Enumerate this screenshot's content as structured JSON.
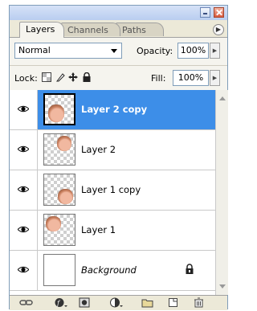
{
  "tabs": [
    {
      "label": "Layers",
      "active": true
    },
    {
      "label": "Channels",
      "active": false
    },
    {
      "label": "Paths",
      "active": false
    }
  ],
  "blend_mode": "Normal",
  "opacity": {
    "label": "Opacity:",
    "value": "100%"
  },
  "lock": {
    "label": "Lock:",
    "icons": [
      "lock-transparent-icon",
      "lock-image-icon",
      "lock-position-icon",
      "lock-all-icon"
    ]
  },
  "fill": {
    "label": "Fill:",
    "value": "100%"
  },
  "layers": [
    {
      "name": "Layer 2 copy",
      "selected": true,
      "visible": true
    },
    {
      "name": "Layer 2",
      "selected": false,
      "visible": true
    },
    {
      "name": "Layer 1 copy",
      "selected": false,
      "visible": true
    },
    {
      "name": "Layer 1",
      "selected": false,
      "visible": true
    },
    {
      "name": "Background",
      "selected": false,
      "visible": true,
      "locked": true
    }
  ],
  "bottom_icons": [
    "link-layers-icon",
    "layer-style-icon",
    "layer-mask-icon",
    "adjustment-layer-icon",
    "new-group-icon",
    "new-layer-icon",
    "delete-layer-icon"
  ],
  "colors": {
    "selection": "#3d8ee8",
    "panel": "#ece9d8"
  }
}
